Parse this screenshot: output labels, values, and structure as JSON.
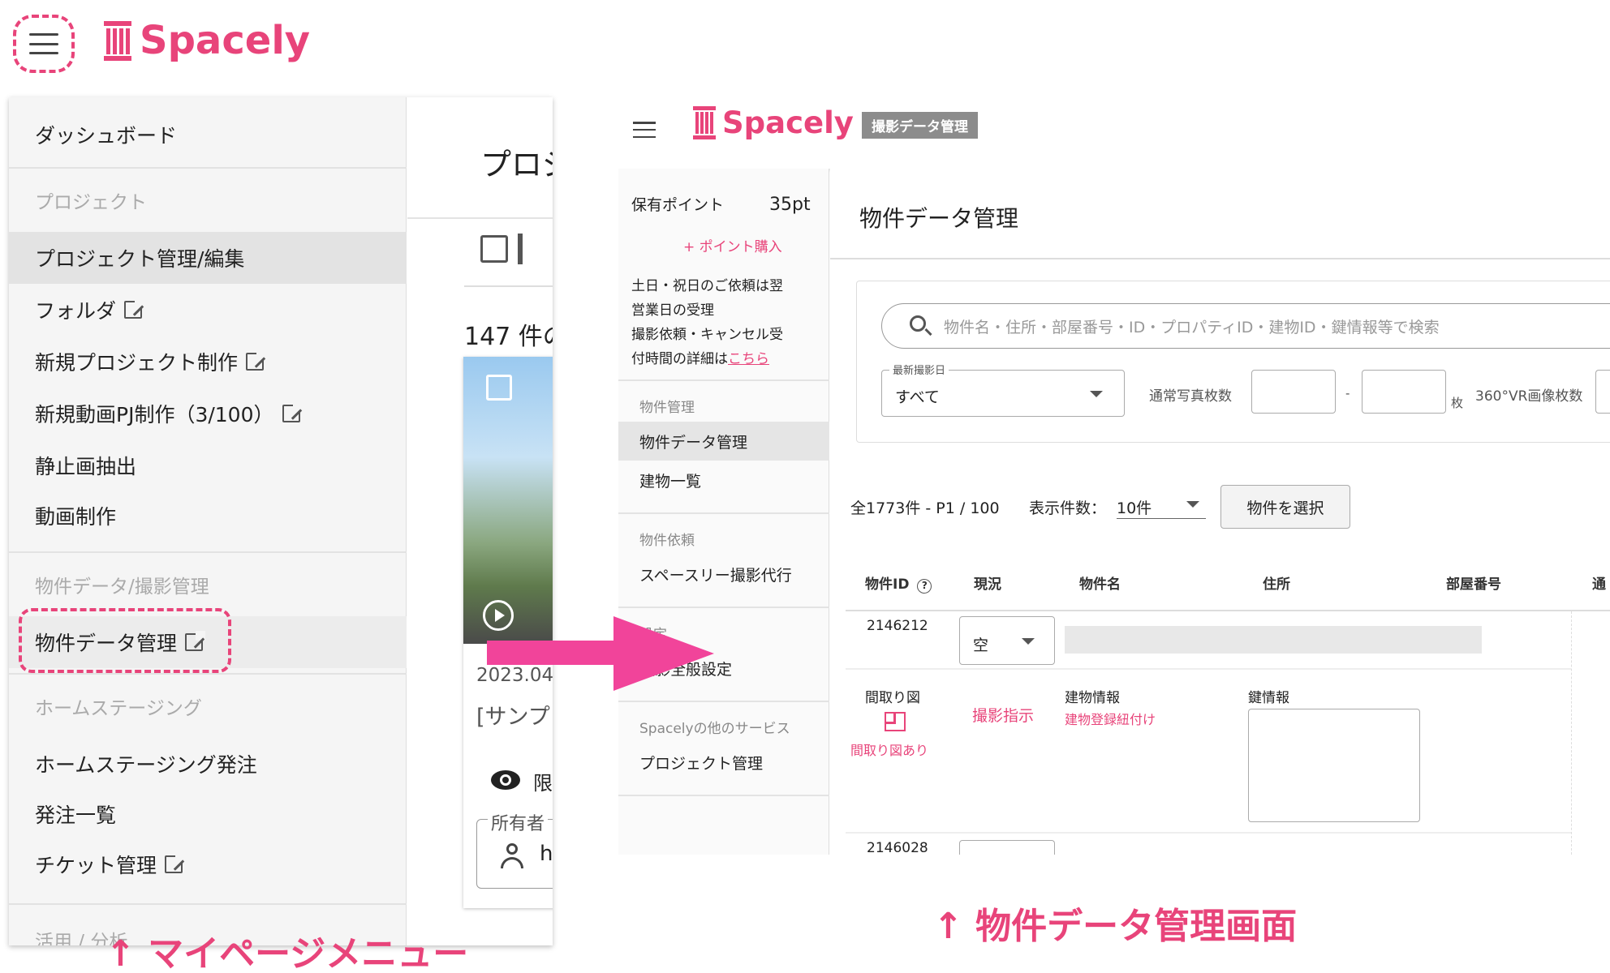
{
  "brand": {
    "name": "Spacely",
    "color": "#e8447a"
  },
  "left_menu": {
    "items": [
      {
        "label": "ダッシュボード"
      },
      {
        "section": "プロジェクト"
      },
      {
        "label": "プロジェクト管理/編集",
        "active": true
      },
      {
        "label": "フォルダ",
        "external": true
      },
      {
        "label": "新規プロジェクト制作",
        "external": true
      },
      {
        "label": "新規動画PJ制作（3/100）",
        "external": true
      },
      {
        "label": "静止画抽出"
      },
      {
        "label": "動画制作"
      },
      {
        "section": "物件データ/撮影管理"
      },
      {
        "label": "物件データ管理",
        "external": true
      },
      {
        "section": "ホームステージング"
      },
      {
        "label": "ホームステージング発注"
      },
      {
        "label": "発注一覧"
      },
      {
        "label": "チケット管理",
        "external": true
      },
      {
        "section": "活用 / 分析"
      }
    ],
    "main": {
      "title": "プロジ",
      "count": "147 件の",
      "card_date": "2023.04",
      "card_title": "[サンプ",
      "visibility": "限",
      "owner_label": "所有者",
      "owner_value": "h"
    }
  },
  "right_panel": {
    "badge": "撮影データ管理",
    "points_label": "保有ポイント",
    "points_value": "35pt",
    "buy_points": "+ ポイント購入",
    "notice_lines": [
      "土日・祝日のご依頼は翌",
      "営業日の受理",
      "撮影依頼・キャンセル受",
      "付時間の詳細は"
    ],
    "notice_link": "こちら",
    "nav": [
      {
        "section": "物件管理"
      },
      {
        "label": "物件データ管理",
        "active": true
      },
      {
        "label": "建物一覧"
      },
      {
        "section": "物件依頼"
      },
      {
        "label": "スペースリー撮影代行"
      },
      {
        "section": "設定"
      },
      {
        "label": "撮影全般設定"
      },
      {
        "section": "Spacelyの他のサービス"
      },
      {
        "label": "プロジェクト管理"
      }
    ],
    "page_title": "物件データ管理",
    "search_placeholder": "物件名・住所・部屋番号・ID・プロパティID・建物ID・鍵情報等で検索",
    "filter": {
      "date_label": "最新撮影日",
      "date_value": "すべて",
      "photo_count_label": "通常写真枚数",
      "range_sep": "-",
      "unit": "枚",
      "vr_label": "360°VR画像枚数"
    },
    "pagination": "全1773件 - P1 / 100",
    "per_page_label": "表示件数：",
    "per_page_value": "10件",
    "select_button": "物件を選択",
    "columns": [
      "物件ID",
      "現況",
      "物件名",
      "住所",
      "部屋番号",
      "通"
    ],
    "rows": [
      {
        "id": "2146212",
        "status": "空"
      },
      {
        "id": "2146028"
      }
    ],
    "detail": {
      "floorplan_label": "間取り図",
      "floorplan_value": "間取り図あり",
      "shoot_instruction": "撮影指示",
      "building_label": "建物情報",
      "building_link": "建物登録紐付け",
      "key_label": "鍵情報"
    }
  },
  "captions": {
    "left": "↑ マイページメニュー",
    "right": "↑ 物件データ管理画面"
  },
  "colors": {
    "accent": "#e8447a",
    "arrow": "#f1449a"
  }
}
